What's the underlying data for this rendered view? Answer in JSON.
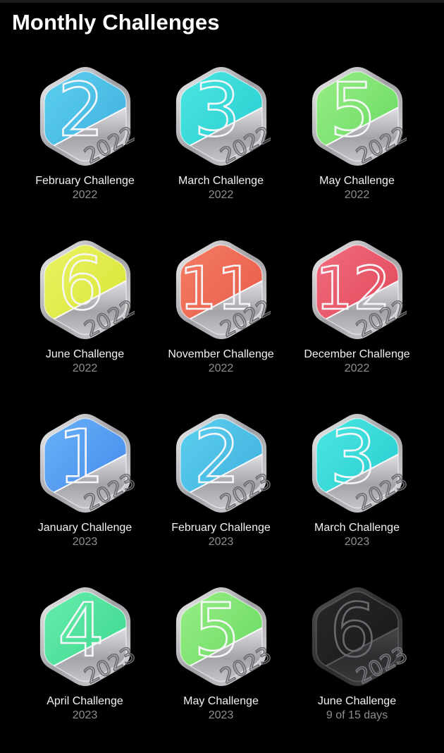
{
  "page": {
    "title": "Monthly Challenges"
  },
  "badges": [
    {
      "name": "February Challenge",
      "subtitle": "2022",
      "month_number": "2",
      "year_text": "2022",
      "color_top": "#5fd4f0",
      "color_bottom": "#3aa9dc",
      "earned": true
    },
    {
      "name": "March Challenge",
      "subtitle": "2022",
      "month_number": "3",
      "year_text": "2022",
      "color_top": "#4fe9e4",
      "color_bottom": "#22c8cc",
      "earned": true
    },
    {
      "name": "May Challenge",
      "subtitle": "2022",
      "month_number": "5",
      "year_text": "2022",
      "color_top": "#9ef08a",
      "color_bottom": "#5fd65a",
      "earned": true
    },
    {
      "name": "June Challenge",
      "subtitle": "2022",
      "month_number": "6",
      "year_text": "2022",
      "color_top": "#eef46a",
      "color_bottom": "#d3e22a",
      "earned": true
    },
    {
      "name": "November Challenge",
      "subtitle": "2022",
      "month_number": "11",
      "year_text": "2022",
      "color_top": "#f5806a",
      "color_bottom": "#e5553f",
      "earned": true
    },
    {
      "name": "December Challenge",
      "subtitle": "2022",
      "month_number": "12",
      "year_text": "2022",
      "color_top": "#f27282",
      "color_bottom": "#dd3f52",
      "earned": true
    },
    {
      "name": "January Challenge",
      "subtitle": "2023",
      "month_number": "1",
      "year_text": "2023",
      "color_top": "#6fb6fa",
      "color_bottom": "#3c82e8",
      "earned": true
    },
    {
      "name": "February Challenge",
      "subtitle": "2023",
      "month_number": "2",
      "year_text": "2023",
      "color_top": "#5fd4f0",
      "color_bottom": "#3aa9dc",
      "earned": true
    },
    {
      "name": "March Challenge",
      "subtitle": "2023",
      "month_number": "3",
      "year_text": "2023",
      "color_top": "#4fe9e4",
      "color_bottom": "#22c8cc",
      "earned": true
    },
    {
      "name": "April Challenge",
      "subtitle": "2023",
      "month_number": "4",
      "year_text": "2023",
      "color_top": "#6df0b0",
      "color_bottom": "#33d287",
      "earned": true
    },
    {
      "name": "May Challenge",
      "subtitle": "2023",
      "month_number": "5",
      "year_text": "2023",
      "color_top": "#9ef08a",
      "color_bottom": "#5fd65a",
      "earned": true
    },
    {
      "name": "June Challenge",
      "subtitle": "9 of 15 days",
      "month_number": "6",
      "year_text": "2023",
      "color_top": "#2a2a2c",
      "color_bottom": "#151516",
      "earned": false
    }
  ]
}
